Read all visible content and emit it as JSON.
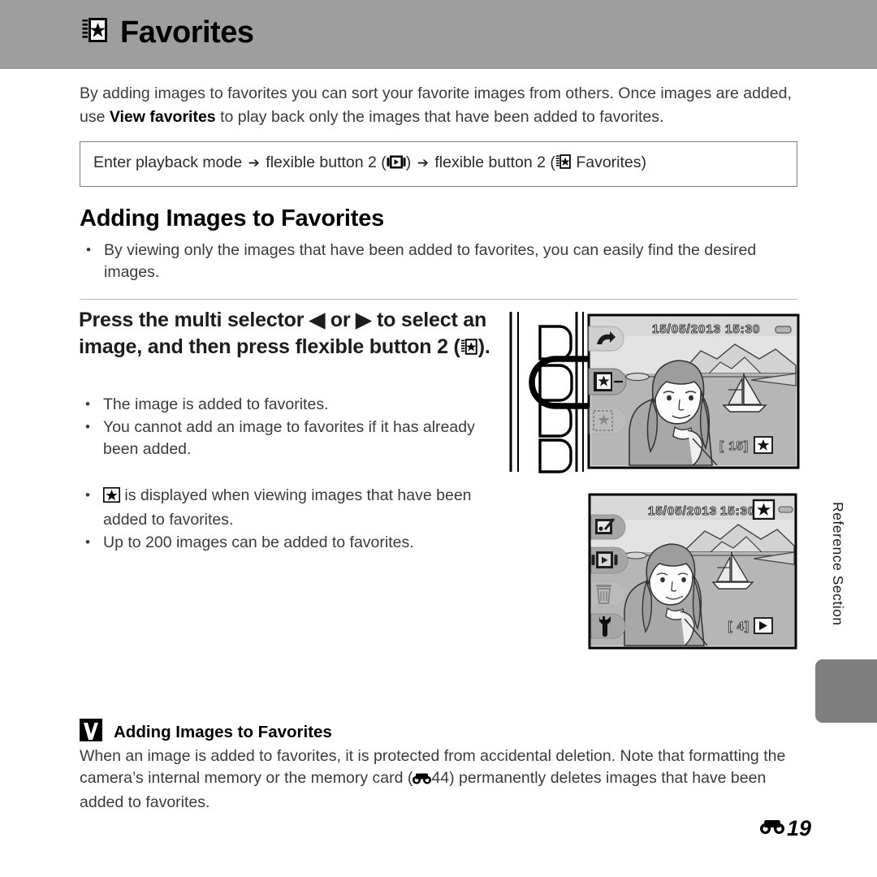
{
  "header": {
    "title": "Favorites",
    "icon": "favorites-album-icon",
    "band_color": "#9e9e9e"
  },
  "intro": {
    "line1": "By adding images to favorites you can sort your favorite images from others. Once images are",
    "line2_prefix": "added, use ",
    "line2_bold": "View favorites",
    "line2_suffix": " to play back only the images that have been added to favorites."
  },
  "path_box": {
    "part1": "Enter playback mode",
    "arrow": "➔",
    "part2": "flexible button 2 (",
    "icon1": "playback-menu-icon",
    "part3": ")",
    "part4": "flexible button 2 (",
    "icon2": "favorites-album-icon",
    "part5": " Favorites)"
  },
  "section": {
    "heading": "Adding Images to Favorites",
    "bullets": [
      "By viewing only the images that have been added to favorites, you can easily find the desired images."
    ]
  },
  "step": {
    "text_line1": "Press the multi selector",
    "left_arrow": "◀",
    "or_word": "or",
    "right_arrow": "▶",
    "text_line2": "to select an image, and then press flexible button 2",
    "text_line3_open": "(",
    "step_icon": "favorites-album-icon",
    "text_line3_close": ").",
    "bullets_a": [
      "The image is added to favorites.",
      "You cannot add an image to favorites if it has already been added."
    ],
    "bullet_b_icon": "favorites-star-box-icon",
    "bullets_b": [
      "is displayed when viewing images that have been added to favorites.",
      "Up to 200 images can be added to favorites."
    ]
  },
  "camera_figure_1": {
    "name": "camera-rear-with-lcd",
    "buttons": [
      {
        "label": "flexible-button-1",
        "highlighted": false
      },
      {
        "label": "flexible-button-2",
        "highlighted": true
      },
      {
        "label": "flexible-button-3",
        "highlighted": false
      },
      {
        "label": "flexible-button-4",
        "highlighted": false
      }
    ],
    "lcd": {
      "date": "15/05/2013",
      "time": "15:30",
      "battery_icon": "battery-full-icon",
      "side_icons": [
        "back-arrow-icon",
        "favorites-album-icon",
        "favorites-slideshow-icon-dimmed"
      ],
      "frame_counter": "[    15]",
      "corner_icon": "favorites-star-box-icon",
      "scene": "woman-with-sailboat-and-mountains"
    }
  },
  "camera_figure_2": {
    "name": "camera-lcd-playback-menu",
    "lcd": {
      "date": "15/05/2013",
      "time": "15:30",
      "top_badge_icon": "favorites-star-box-icon",
      "battery_icon": "battery-full-icon",
      "side_icons": [
        "retouch-icon",
        "playback-menu-icon",
        "delete-trash-icon-dimmed",
        "setup-wrench-icon"
      ],
      "frame_counter": "[     4]",
      "corner_icon": "playback-mode-icon",
      "scene": "woman-with-sailboat-and-mountains"
    }
  },
  "reference_tab": {
    "label": "Reference Section",
    "block_color": "#7f7f7f"
  },
  "note": {
    "icon": "caution-checkmark-icon",
    "title": "Adding Images to Favorites",
    "body_part1": "When an image is added to favorites, it is protected from accidental deletion. Note that formatting the camera’s internal memory or the memory card (",
    "body_ref_icon": "reference-section-symbol",
    "body_ref_num": "44",
    "body_part2": ") permanently deletes images that have been added to favorites."
  },
  "page_number": {
    "symbol_icon": "reference-section-symbol",
    "value": "19"
  }
}
